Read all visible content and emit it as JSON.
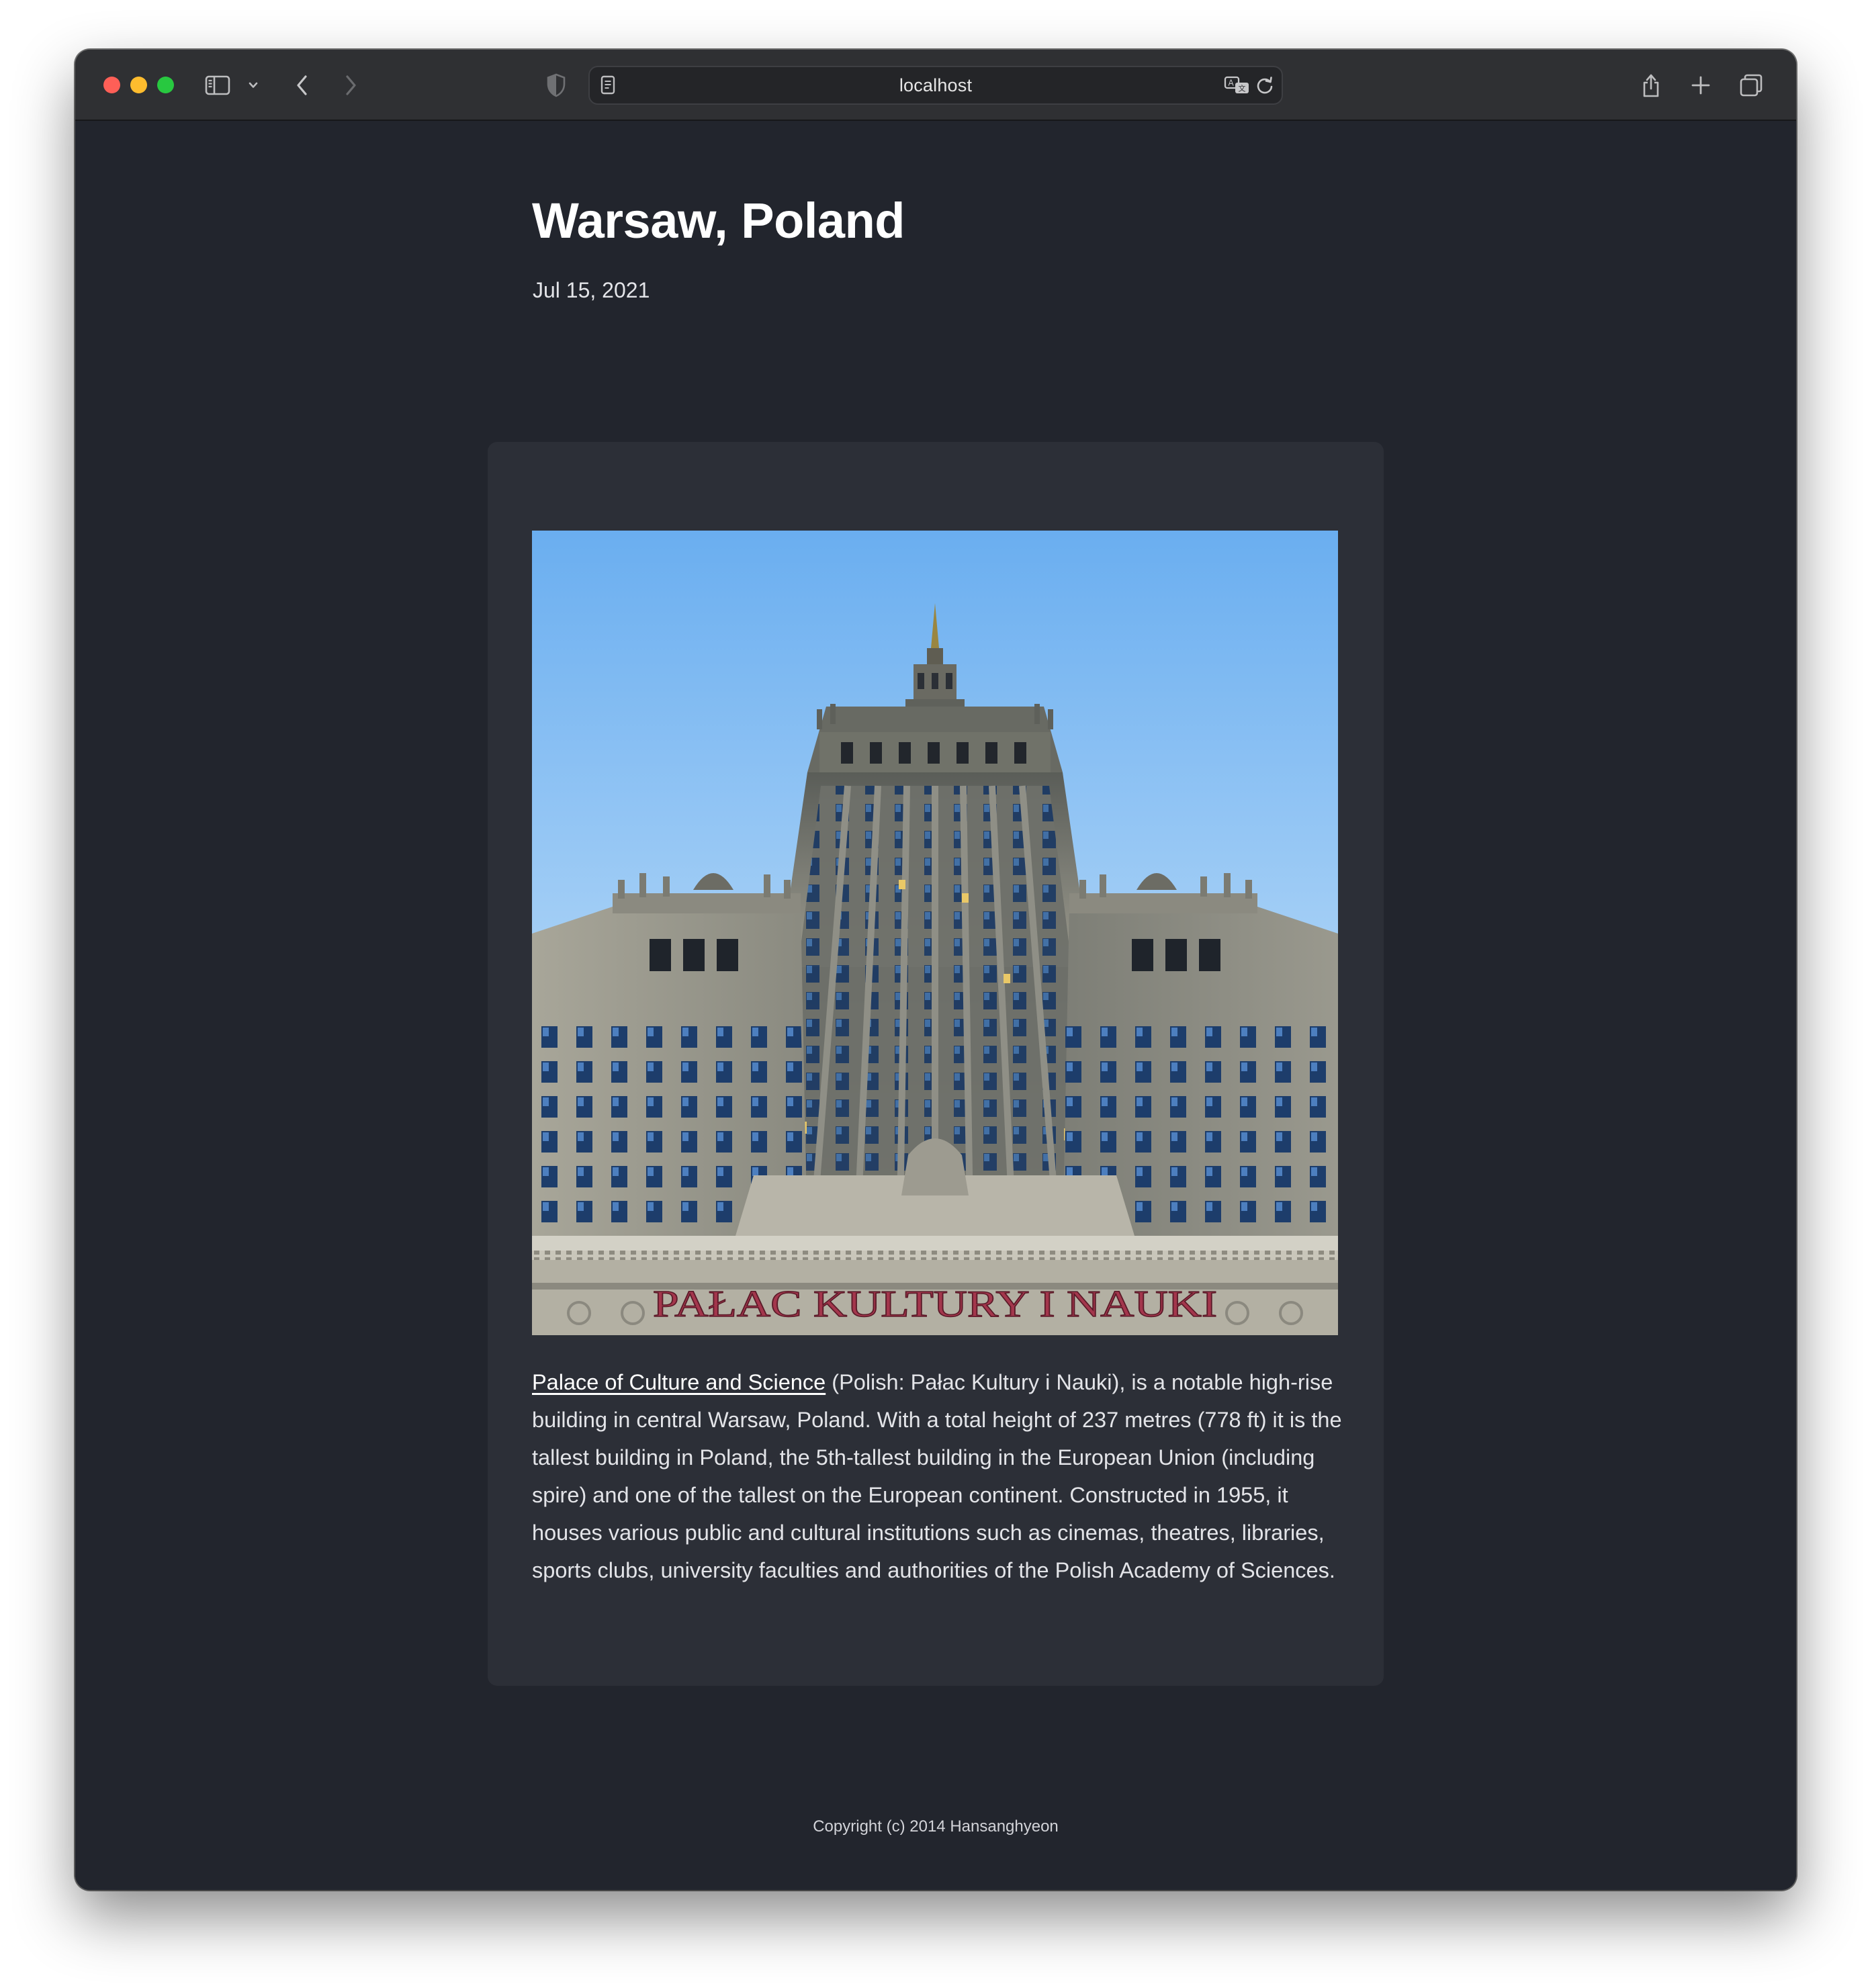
{
  "browser": {
    "url": "localhost",
    "icons": {
      "sidebar": "sidebar-icon",
      "back": "chevron-left-icon",
      "forward": "chevron-right-icon",
      "privacy": "shield-icon",
      "page": "page-icon",
      "translate": "translate-icon",
      "reload": "reload-icon",
      "share": "share-icon",
      "new_tab": "plus-icon",
      "tabs": "tabs-overview-icon"
    }
  },
  "post": {
    "title": "Warsaw, Poland",
    "date": "Jul 15, 2021",
    "photo_sign": "PAŁAC KULTURY I NAUKI",
    "link_text": "Palace of Culture and Science",
    "body_text": " (Polish: Pałac Kultury i Nauki), is a notable high-rise building in central Warsaw, Poland. With a total height of 237 metres (778 ft) it is the tallest building in Poland, the 5th-tallest building in the European Union (including spire) and one of the tallest on the European continent. Constructed in 1955, it houses various public and cultural institutions such as cinemas, theatres, libraries, sports clubs, university faculties and authorities of the Polish Academy of Sciences."
  },
  "footer": {
    "copyright": "Copyright (c) 2014 Hansanghyeon"
  },
  "colors": {
    "page_background": "#22252d",
    "card_background": "#2c2f37",
    "text": "#e3e4e8",
    "title": "#ffffff"
  }
}
